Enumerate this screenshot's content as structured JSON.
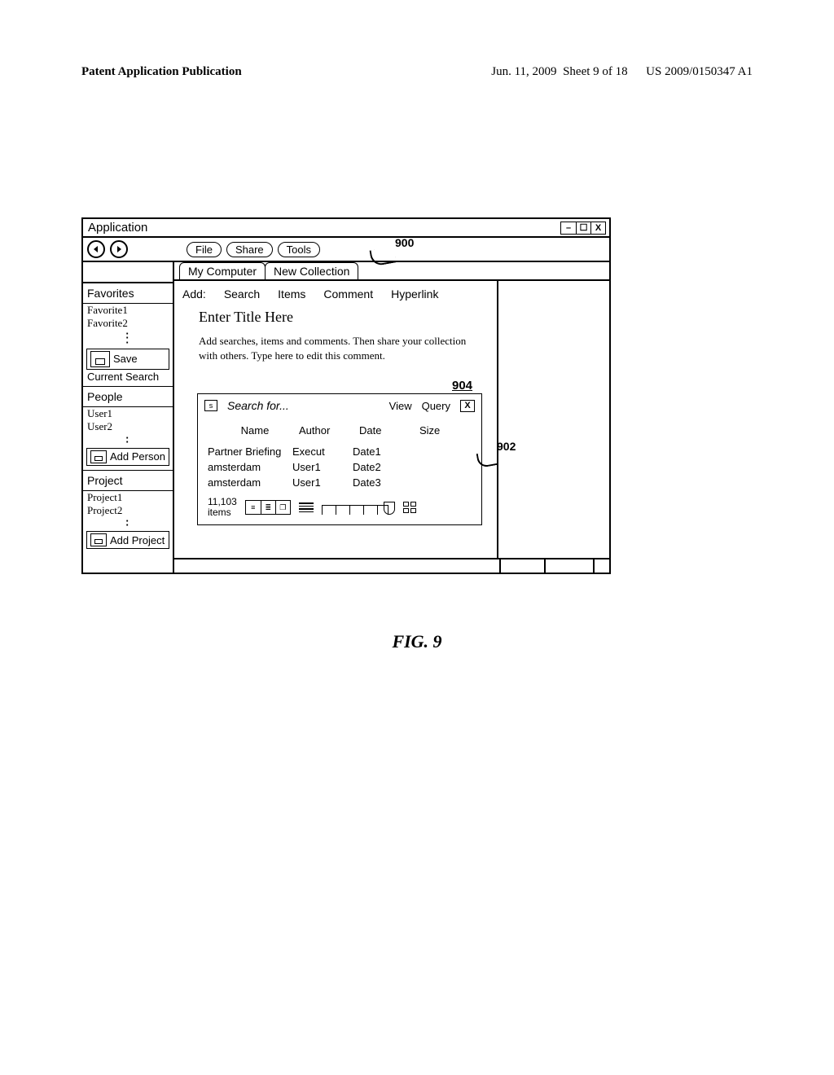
{
  "pub": {
    "left": "Patent Application Publication",
    "date": "Jun. 11, 2009",
    "sheet": "Sheet 9 of 18",
    "docnum": "US 2009/0150347 A1"
  },
  "refs": {
    "r900": "900",
    "r902": "902",
    "r904": "904"
  },
  "window": {
    "title": "Application",
    "minimize": "–",
    "maximize": "☐",
    "close": "X",
    "back": "⦿",
    "forward": "⦿",
    "menu": {
      "file": "File",
      "share": "Share",
      "tools": "Tools"
    },
    "tabs": {
      "mycomputer": "My Computer",
      "newcollection": "New Collection"
    }
  },
  "sidebar": {
    "favorites_head": "Favorites",
    "favorites": [
      "Favorite1",
      "Favorite2"
    ],
    "save_btn": "Save",
    "save_sub": "Current Search",
    "people_head": "People",
    "people": [
      "User1",
      "User2"
    ],
    "add_person": "Add Person",
    "project_head": "Project",
    "projects": [
      "Project1",
      "Project2"
    ],
    "add_project": "Add Project"
  },
  "add_row": {
    "label": "Add:",
    "search": "Search",
    "items": "Items",
    "comment": "Comment",
    "hyperlink": "Hyperlink"
  },
  "editor": {
    "title_ph": "Enter Title Here",
    "subtext": "Add searches, items and comments.  Then share your collection with others.  Type here to edit this comment."
  },
  "search": {
    "s": "s",
    "placeholder": "Search for...",
    "view": "View",
    "query": "Query",
    "x": "X",
    "cols": {
      "name": "Name",
      "author": "Author",
      "date": "Date",
      "size": "Size"
    },
    "rows": [
      {
        "name": "Partner Briefing",
        "author": "Execut",
        "date": "Date1",
        "size": ""
      },
      {
        "name": "amsterdam",
        "author": "User1",
        "date": "Date2",
        "size": ""
      },
      {
        "name": "amsterdam",
        "author": "User1",
        "date": "Date3",
        "size": ""
      }
    ],
    "count": "11,103",
    "count_label": "items"
  },
  "figure": "FIG. 9"
}
